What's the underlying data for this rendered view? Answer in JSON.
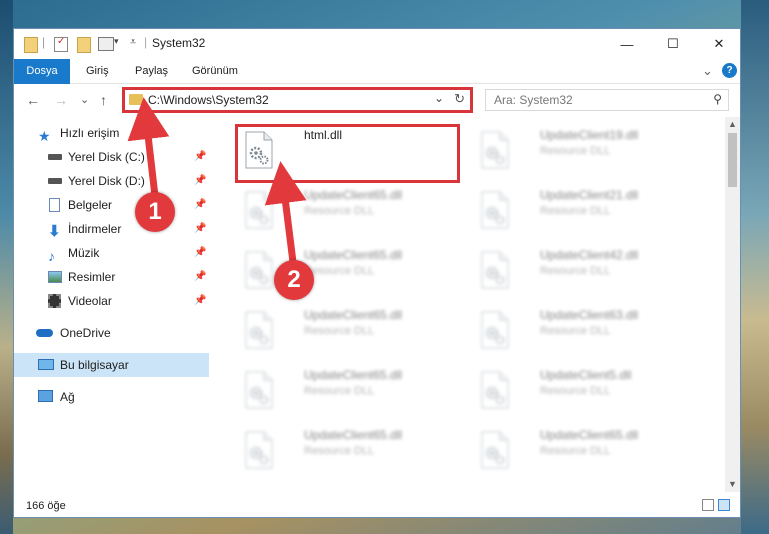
{
  "window": {
    "title": "System32",
    "minimize_glyph": "—",
    "maximize_glyph": "☐",
    "close_glyph": "✕"
  },
  "ribbon": {
    "tabs": [
      "Dosya",
      "Giriş",
      "Paylaş",
      "Görünüm"
    ],
    "expand_glyph": "⌄",
    "help_glyph": "?"
  },
  "address_bar": {
    "path": "C:\\Windows\\System32",
    "dropdown_glyph": "⌄",
    "refresh_glyph": "↻"
  },
  "nav_buttons": {
    "back": "←",
    "forward": "→",
    "recent": "⌄",
    "up": "↑"
  },
  "search": {
    "placeholder": "Ara: System32",
    "icon": "search-icon"
  },
  "nav_pane": {
    "items": [
      {
        "label": "Hızlı erişim",
        "icon": "star-icon",
        "pinned": false
      },
      {
        "label": "Yerel Disk (C:)",
        "icon": "drive-icon",
        "pinned": true
      },
      {
        "label": "Yerel Disk (D:)",
        "icon": "drive-icon",
        "pinned": true
      },
      {
        "label": "Belgeler",
        "icon": "documents-icon",
        "pinned": true
      },
      {
        "label": "İndirmeler",
        "icon": "download-icon",
        "pinned": true
      },
      {
        "label": "Müzik",
        "icon": "music-icon",
        "pinned": true
      },
      {
        "label": "Resimler",
        "icon": "pictures-icon",
        "pinned": true
      },
      {
        "label": "Videolar",
        "icon": "videos-icon",
        "pinned": true
      },
      {
        "label": "OneDrive",
        "icon": "cloud-icon",
        "pinned": false
      },
      {
        "label": "Bu bilgisayar",
        "icon": "computer-icon",
        "pinned": false,
        "selected": true
      },
      {
        "label": "Ağ",
        "icon": "network-icon",
        "pinned": false
      }
    ],
    "pin_glyph": "📌"
  },
  "files": {
    "left_column": [
      {
        "name": "html.dll",
        "type": "",
        "blurred": false,
        "highlighted": true
      },
      {
        "name": "UpdateClient65.dll",
        "type": "Resource DLL",
        "blurred": true
      },
      {
        "name": "UpdateClient65.dll",
        "type": "Resource DLL",
        "blurred": true
      },
      {
        "name": "UpdateClient65.dll",
        "type": "Resource DLL",
        "blurred": true
      },
      {
        "name": "UpdateClient65.dll",
        "type": "Resource DLL",
        "blurred": true
      },
      {
        "name": "UpdateClient65.dll",
        "type": "Resource DLL",
        "blurred": true
      }
    ],
    "right_column": [
      {
        "name": "UpdateClient19.dll",
        "type": "Resource DLL",
        "blurred": true
      },
      {
        "name": "UpdateClient21.dll",
        "type": "Resource DLL",
        "blurred": true
      },
      {
        "name": "UpdateClient42.dll",
        "type": "Resource DLL",
        "blurred": true
      },
      {
        "name": "UpdateClient63.dll",
        "type": "Resource DLL",
        "blurred": true
      },
      {
        "name": "UpdateClient5.dll",
        "type": "Resource DLL",
        "blurred": true
      },
      {
        "name": "UpdateClient65.dll",
        "type": "Resource DLL",
        "blurred": true
      }
    ]
  },
  "status_bar": {
    "item_count": "166 öğe"
  },
  "annotations": {
    "step1": "1",
    "step2": "2",
    "color": "#e2393d"
  },
  "colors": {
    "accent": "#1979ca",
    "highlight": "#d8353a",
    "selection": "#cce4f7"
  }
}
